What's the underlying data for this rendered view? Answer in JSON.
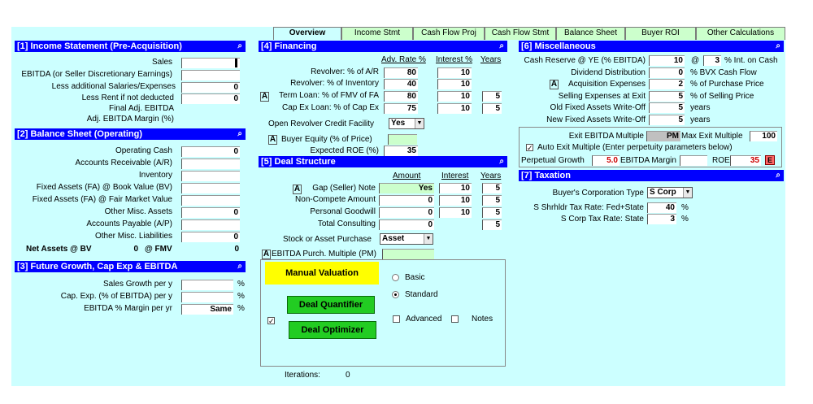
{
  "tabs": [
    "Overview",
    "Income Stmt",
    "Cash Flow Proj",
    "Cash Flow Stmt",
    "Balance Sheet",
    "Buyer ROI",
    "Other Calculations"
  ],
  "icon_glyph": "⌕",
  "sec1": {
    "title": "[1] Income Statement (Pre-Acquisition)",
    "rows": [
      {
        "label": "Sales",
        "value": ""
      },
      {
        "label": "EBITDA (or Seller Discretionary Earnings)",
        "value": ""
      },
      {
        "label": "Less additional Salaries/Expenses",
        "value": "0"
      },
      {
        "label": "Less Rent if not deducted",
        "value": "0"
      }
    ],
    "final_ebitda": "Final Adj. EBITDA",
    "margin": "Adj. EBITDA Margin (%)"
  },
  "sec2": {
    "title": "[2] Balance Sheet (Operating)",
    "rows": [
      {
        "label": "Operating Cash",
        "value": "0"
      },
      {
        "label": "Accounts Receivable (A/R)",
        "value": ""
      },
      {
        "label": "Inventory",
        "value": ""
      },
      {
        "label": "Fixed Assets (FA) @ Book Value (BV)",
        "value": ""
      },
      {
        "label": "Fixed Assets (FA) @ Fair Market Value",
        "value": ""
      },
      {
        "label": "Other Misc. Assets",
        "value": "0"
      },
      {
        "label": "Accounts Payable (A/P)",
        "value": ""
      },
      {
        "label": "Other Misc. Liabilities",
        "value": "0"
      }
    ],
    "net_assets_label": "Net Assets @ BV",
    "net_assets_bv": "0",
    "fmv_label": "@ FMV",
    "net_assets_fmv": "0"
  },
  "sec3": {
    "title": "[3] Future Growth, Cap Exp & EBITDA",
    "rows": [
      {
        "label": "Sales Growth per y",
        "value": "",
        "unit": "%"
      },
      {
        "label": "Cap. Exp. (% of EBITDA) per y",
        "value": "",
        "unit": "%"
      },
      {
        "label": "EBITDA % Margin per yr",
        "value": "Same",
        "unit": "%"
      }
    ]
  },
  "sec4": {
    "title": "[4] Financing",
    "col_adv": "Adv. Rate %",
    "col_int": "Interest %",
    "col_yrs": "Years",
    "rows": [
      {
        "label": "Revolver:  % of A/R",
        "adv": "80",
        "int": "10",
        "yrs": ""
      },
      {
        "label": "Revolver:  % of Inventory",
        "adv": "40",
        "int": "10",
        "yrs": ""
      },
      {
        "label": "Term Loan: % of FMV of FA",
        "adv": "80",
        "int": "10",
        "yrs": "5"
      },
      {
        "label": "Cap Ex Loan: % of Cap Ex",
        "adv": "75",
        "int": "10",
        "yrs": "5"
      }
    ],
    "open_revolver_label": "Open Revolver Credit Facility",
    "open_revolver_value": "Yes",
    "buyer_equity_label": "Buyer Equity (% of Price)",
    "buyer_equity_value": "",
    "roe_label": "Expected ROE (%)",
    "roe_value": "35",
    "a_glyph": "A"
  },
  "sec5": {
    "title": "[5] Deal Structure",
    "col_amount": "Amount",
    "col_int": "Interest",
    "col_yrs": "Years",
    "rows": [
      {
        "label": "Gap (Seller) Note",
        "amount": "Yes",
        "int": "10",
        "yrs": "5"
      },
      {
        "label": "Non-Compete Amount",
        "amount": "0",
        "int": "10",
        "yrs": "5"
      },
      {
        "label": "Personal Goodwill",
        "amount": "0",
        "int": "10",
        "yrs": "5"
      },
      {
        "label": "Total Consulting",
        "amount": "0",
        "int": "",
        "yrs": "5"
      }
    ],
    "purchase_label": "Stock or Asset Purchase",
    "purchase_value": "Asset",
    "multiple_label": "EBITDA Purch. Multiple (PM)",
    "multiple_value": ""
  },
  "valuation": {
    "manual": "Manual Valuation",
    "quantifier": "Deal Quantifier",
    "optimizer": "Deal Optimizer",
    "basic": "Basic",
    "standard": "Standard",
    "advanced": "Advanced",
    "notes": "Notes",
    "iterations_label": "Iterations:",
    "iterations_value": "0",
    "check_mark": "✓"
  },
  "sec6": {
    "title": "[6] Miscellaneous",
    "cash_reserve_label": "Cash Reserve @ YE (% EBITDA)",
    "cash_reserve_value": "10",
    "at": "@",
    "cash_int_value": "3",
    "cash_int_label": "% Int. on Cash",
    "rows": [
      {
        "label": "Dividend Distribution",
        "value": "0",
        "unit": "% BVX Cash Flow"
      },
      {
        "label": "Acquisition Expenses",
        "value": "2",
        "unit": "% of Purchase Price"
      },
      {
        "label": "Selling Expenses at Exit",
        "value": "5",
        "unit": "% of Selling Price"
      },
      {
        "label": "Old Fixed Assets Write-Off",
        "value": "5",
        "unit": "years"
      },
      {
        "label": "New Fixed Assets Write-Off",
        "value": "5",
        "unit": "years"
      }
    ],
    "exit_multiple_label": "Exit EBITDA Multiple",
    "exit_multiple_value": "PM",
    "max_exit_label": "Max Exit Multiple",
    "max_exit_value": "100",
    "auto_exit_label": "Auto Exit Multiple (Enter perpetuity parameters below)",
    "perp_growth_label": "Perpetual Growth",
    "perp_growth_value": "5.0",
    "ebitda_margin_label": "EBITDA Margin",
    "ebitda_margin_value": "",
    "roe_label": "ROE",
    "roe_value": "35",
    "e_glyph": "E"
  },
  "sec7": {
    "title": "[7] Taxation",
    "corp_type_label": "Buyer's Corporation Type",
    "corp_type_value": "S Corp",
    "fed_state_label": "S Shrhldr Tax Rate: Fed+State",
    "fed_state_value": "40",
    "state_label": "S Corp Tax Rate: State",
    "state_value": "3",
    "pct": "%"
  }
}
